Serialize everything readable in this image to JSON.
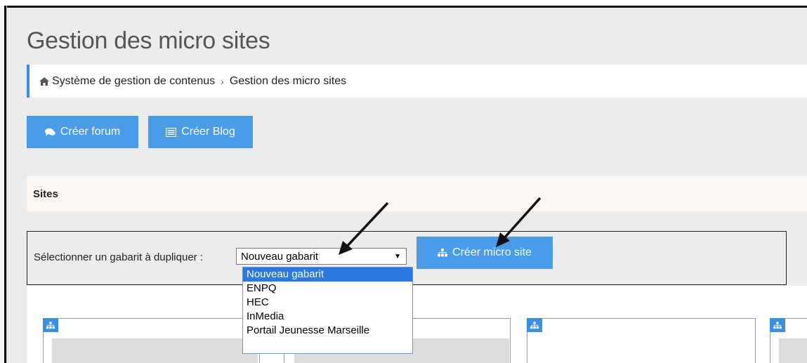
{
  "page": {
    "title": "Gestion des micro sites"
  },
  "breadcrumb": {
    "home_icon": "home-icon",
    "items": [
      "Système de gestion de contenus",
      "Gestion des micro sites"
    ],
    "separator": "›"
  },
  "toolbar": {
    "forum_label": "Créer forum",
    "forum_icon": "comments-icon",
    "blog_label": "Créer Blog",
    "blog_icon": "list-icon"
  },
  "sites": {
    "header": "Sites"
  },
  "template_select": {
    "label": "Sélectionner un gabarit à dupliquer :",
    "selected": "Nouveau gabarit",
    "options": [
      "Nouveau gabarit",
      "ENPQ",
      "HEC",
      "InMedia",
      "Portail Jeunesse Marseille"
    ]
  },
  "create_micro_site": {
    "label": "Créer micro site",
    "icon": "sitemap-icon"
  },
  "colors": {
    "primary": "#4a9be8",
    "accent_border": "#3b8fe0",
    "dropdown_highlight": "#2a78e0",
    "page_bg": "#ececec"
  },
  "card_icon": "sitemap-icon"
}
